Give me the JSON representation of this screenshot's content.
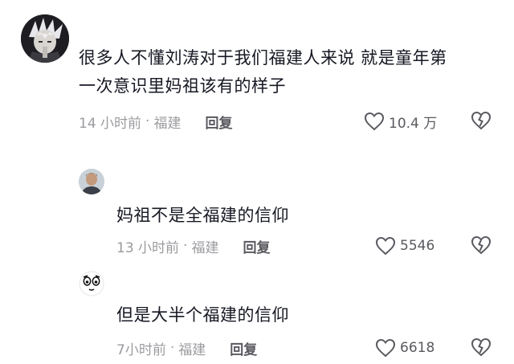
{
  "comments": [
    {
      "text_line1": "很多人不懂刘涛对于我们福建人来说 就是童年第",
      "text_line2": "一次意识里妈祖该有的样子",
      "time": "14 小时前",
      "location": "福建",
      "reply_label": "回复",
      "likes": "10.4 万",
      "avatar_icon": "anime-avatar"
    },
    {
      "text": "妈祖不是全福建的信仰",
      "time": "13 小时前",
      "location": "福建",
      "reply_label": "回复",
      "likes": "5546",
      "avatar_icon": "man-avatar"
    },
    {
      "text": "但是大半个福建的信仰",
      "time": "7小时前",
      "location": "福建",
      "reply_label": "回复",
      "likes": "6618",
      "avatar_icon": "cartoon-face-avatar"
    }
  ]
}
